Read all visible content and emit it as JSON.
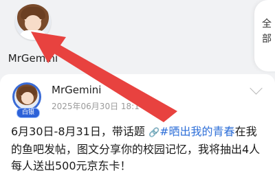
{
  "top": {
    "user_name": "MrGemini",
    "all_tab_label": "全部"
  },
  "post": {
    "author": "MrGemini",
    "badge": "白银",
    "meta": "2025年06月30日 18:1",
    "text_part1": "6月30日-8月31日，带话题 ",
    "link_icon": "🔗",
    "topic": "#晒出我的青春",
    "text_part2": "在我的鱼吧发帖，图文分享你的校园记忆，我将抽出4人每人送出500元京东卡！"
  },
  "annotation": {
    "arrow_color": "#e8423f"
  },
  "colors": {
    "topic_blue": "#2e6fd8",
    "badge_blue": "#2d62d8",
    "background": "#f1f2f4"
  }
}
